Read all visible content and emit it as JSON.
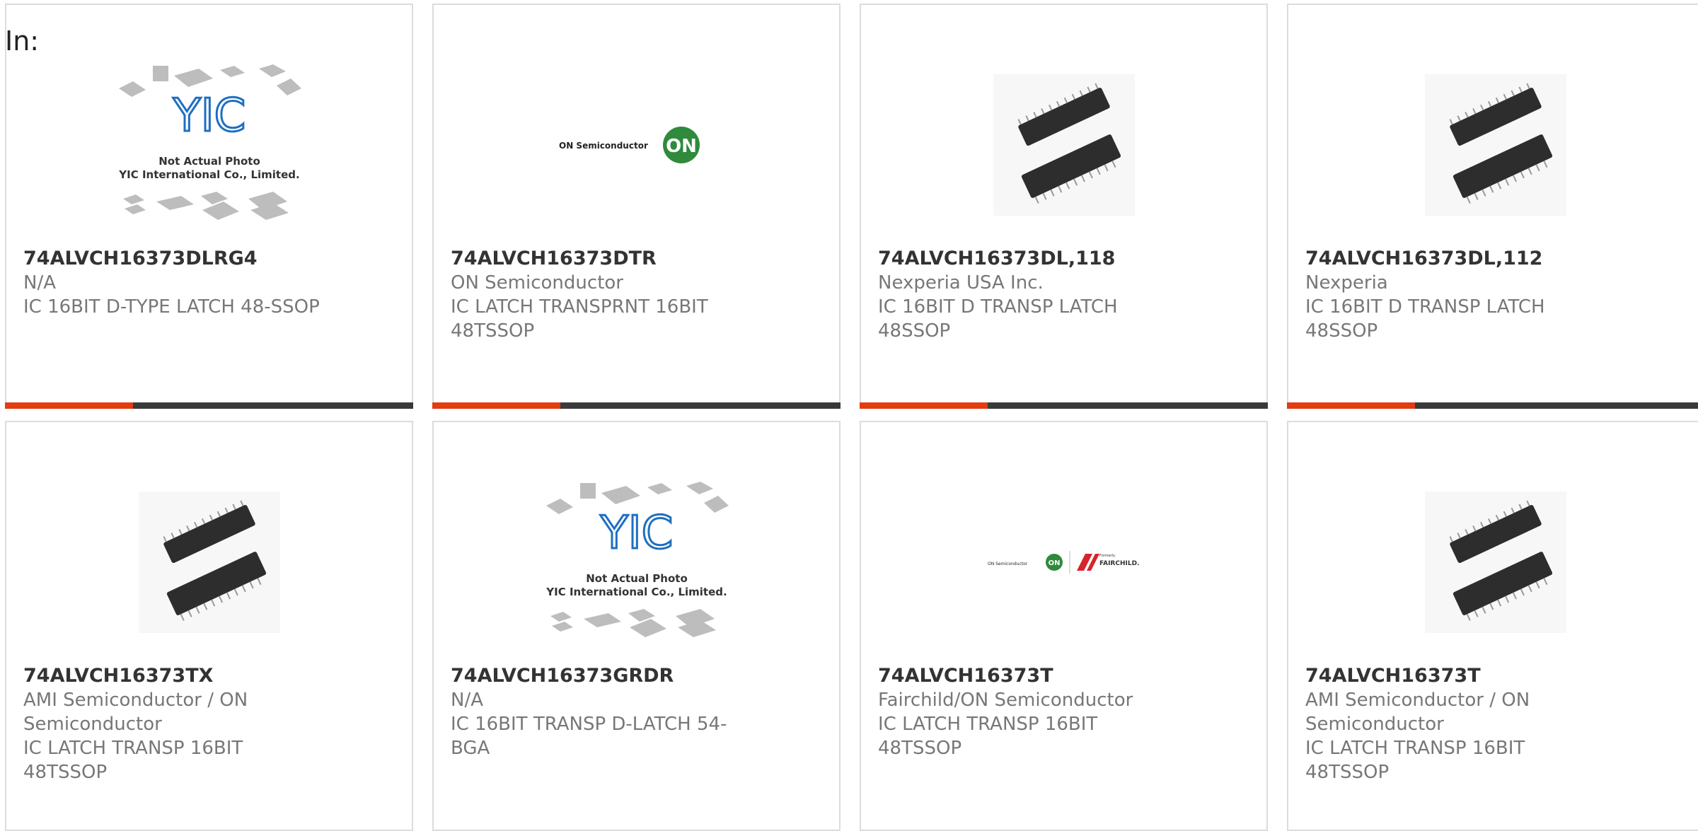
{
  "header": {
    "label": "In:"
  },
  "colors": {
    "accent": "#e23c10",
    "bar": "#3a3a3a",
    "border": "#dcdcdc"
  },
  "placeholder_photo": {
    "line1": "Not Actual Photo",
    "line2": "YIC International Co., Limited.",
    "logo": "YIC"
  },
  "products": [
    {
      "part": "74ALVCH16373DLRG4",
      "manufacturer": "N/A",
      "desc1": "IC 16BIT D-TYPE LATCH 48-SSOP",
      "desc2": "",
      "photo": "yic-placeholder"
    },
    {
      "part": "74ALVCH16373DTR",
      "manufacturer": "ON Semiconductor",
      "desc1": "IC LATCH TRANSPRNT 16BIT",
      "desc2": "48TSSOP",
      "photo": "on-semi-logo",
      "logo_text": "ON Semiconductor",
      "logo_badge": "ON"
    },
    {
      "part": "74ALVCH16373DL,118",
      "manufacturer": "Nexperia USA Inc.",
      "desc1": "IC 16BIT D TRANSP LATCH",
      "desc2": "48SSOP",
      "photo": "chip-ssop"
    },
    {
      "part": "74ALVCH16373DL,112",
      "manufacturer": "Nexperia",
      "desc1": "IC 16BIT D TRANSP LATCH",
      "desc2": "48SSOP",
      "photo": "chip-ssop"
    },
    {
      "part": "74ALVCH16373TX",
      "manufacturer": "AMI Semiconductor / ON",
      "manufacturer2": "Semiconductor",
      "desc1": "IC LATCH TRANSP 16BIT",
      "desc2": "48TSSOP",
      "photo": "chip-ssop"
    },
    {
      "part": "74ALVCH16373GRDR",
      "manufacturer": "N/A",
      "desc1": "IC 16BIT TRANSP D-LATCH 54-",
      "desc2": "BGA",
      "photo": "yic-placeholder"
    },
    {
      "part": "74ALVCH16373T",
      "manufacturer": "Fairchild/ON Semiconductor",
      "desc1": "IC LATCH TRANSP 16BIT",
      "desc2": "48TSSOP",
      "photo": "fairchild-logo",
      "logo_text": "ON Semiconductor",
      "logo_badge": "ON",
      "logo_small": "Formerly",
      "logo_brand": "FAIRCHILD."
    },
    {
      "part": "74ALVCH16373T",
      "manufacturer": "AMI Semiconductor / ON",
      "manufacturer2": "Semiconductor",
      "desc1": "IC LATCH TRANSP 16BIT",
      "desc2": "48TSSOP",
      "photo": "chip-ssop"
    }
  ]
}
